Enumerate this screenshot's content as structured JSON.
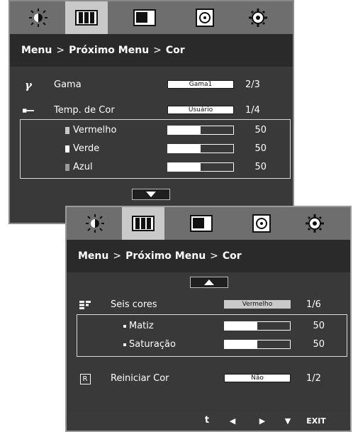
{
  "panel1": {
    "breadcrumb": {
      "menu": "Menu",
      "sep1": ">",
      "next": "Próximo Menu",
      "sep2": ">",
      "current": "Cor"
    },
    "rows": {
      "gama": {
        "label": "Gama",
        "value": "Gama1",
        "position": "2/3"
      },
      "temp": {
        "label": "Temp. de Cor",
        "value": "Usuário",
        "position": "1/4"
      },
      "vermelho": {
        "label": "Vermelho",
        "value": 50,
        "fill": 0.5
      },
      "verde": {
        "label": "Verde",
        "value": 50,
        "fill": 0.5
      },
      "azul": {
        "label": "Azul",
        "value": 50,
        "fill": 0.5
      }
    }
  },
  "panel2": {
    "breadcrumb": {
      "menu": "Menu",
      "sep1": ">",
      "next": "Próximo Menu",
      "sep2": ">",
      "current": "Cor"
    },
    "rows": {
      "seis": {
        "label": "Seis cores",
        "value": "Vermelho",
        "position": "1/6"
      },
      "matiz": {
        "label": "Matiz",
        "value": 50,
        "fill": 0.5
      },
      "saturacao": {
        "label": "Saturação",
        "value": 50,
        "fill": 0.5
      },
      "reiniciar": {
        "label": "Reiniciar Cor",
        "value": "Não",
        "position": "1/2"
      }
    },
    "footer": {
      "exit": "EXIT"
    }
  },
  "icons": [
    "brightness-icon",
    "color-bars-icon",
    "picture-icon",
    "disc-icon",
    "gear-icon"
  ]
}
